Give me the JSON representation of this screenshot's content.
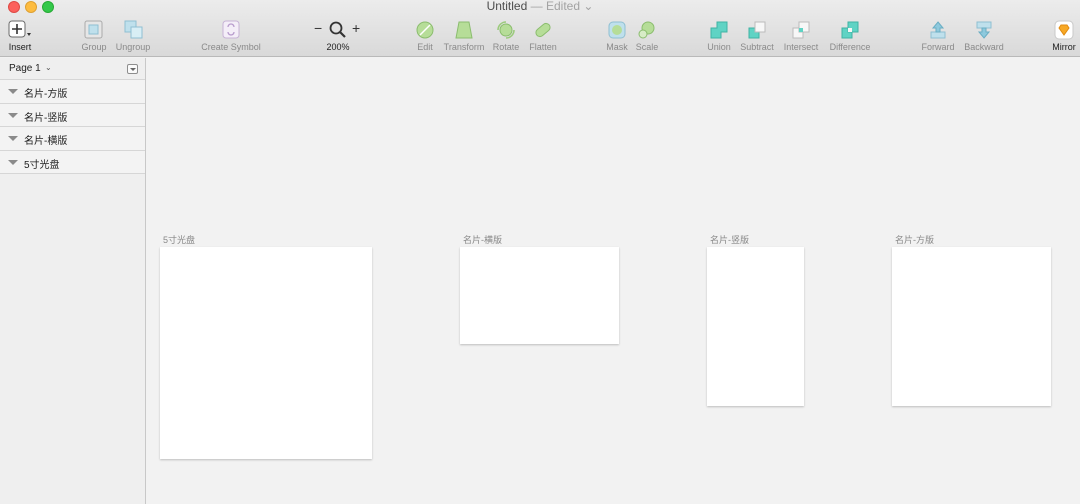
{
  "window": {
    "title": "Untitled",
    "separator": "—",
    "status": "Edited",
    "status_caret": "⌄"
  },
  "toolbar": {
    "insert": "Insert",
    "group": "Group",
    "ungroup": "Ungroup",
    "create_symbol": "Create Symbol",
    "zoom_out": "−",
    "zoom_in": "+",
    "zoom_level": "200%",
    "edit": "Edit",
    "transform": "Transform",
    "rotate": "Rotate",
    "flatten": "Flatten",
    "mask": "Mask",
    "scale": "Scale",
    "union": "Union",
    "subtract": "Subtract",
    "intersect": "Intersect",
    "difference": "Difference",
    "forward": "Forward",
    "backward": "Backward",
    "mirror": "Mirror"
  },
  "sidebar": {
    "page": "Page 1",
    "page_caret": "⌄",
    "layers": [
      {
        "label": "名片-方版"
      },
      {
        "label": "名片-竖版"
      },
      {
        "label": "名片-横版"
      },
      {
        "label": "5寸光盘"
      }
    ]
  },
  "canvas": {
    "artboards": [
      {
        "label": "5寸光盘"
      },
      {
        "label": "名片-横版"
      },
      {
        "label": "名片-竖版"
      },
      {
        "label": "名片-方版"
      }
    ]
  },
  "colors": {
    "accent_teal": "#5fd3c4",
    "icon_green": "#a8d58a",
    "canvas_bg": "#f2f2f2"
  }
}
